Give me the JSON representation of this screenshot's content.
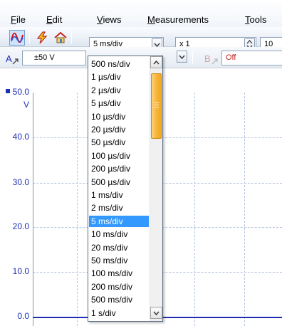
{
  "menubar": {
    "items": [
      {
        "accel": "F",
        "rest": "ile"
      },
      {
        "accel": "E",
        "rest": "dit"
      },
      {
        "accel": "V",
        "rest": "iews"
      },
      {
        "accel": "M",
        "rest": "easurements"
      },
      {
        "accel": "T",
        "rest": "ools"
      }
    ]
  },
  "toolbar": {
    "timebase_value": "5 ms/div",
    "zoom_value": "x 1",
    "samples_partial": "10"
  },
  "toolbar2": {
    "channel_a_label": "A",
    "channel_a_range": "±50 V",
    "channel_b_label": "B",
    "channel_b_coupling": "Off"
  },
  "plot": {
    "y_unit": "V",
    "y_ticks": [
      "50.0",
      "40.0",
      "30.0",
      "20.0",
      "10.0",
      "0.0"
    ],
    "trace_color": "#1e2fb4"
  },
  "dropdown": {
    "options": [
      "500 ns/div",
      "1 µs/div",
      "2 µs/div",
      "5 µs/div",
      "10 µs/div",
      "20 µs/div",
      "50 µs/div",
      "100 µs/div",
      "200 µs/div",
      "500 µs/div",
      "1 ms/div",
      "2 ms/div",
      "5 ms/div",
      "10 ms/div",
      "20 ms/div",
      "50 ms/div",
      "100 ms/div",
      "200 ms/div",
      "500 ms/div",
      "1 s/div"
    ],
    "selected": "5 ms/div"
  },
  "colors": {
    "accent": "#3399ff",
    "scroll_thumb": "#f7b53a",
    "axis_text": "#1c2fb4"
  }
}
